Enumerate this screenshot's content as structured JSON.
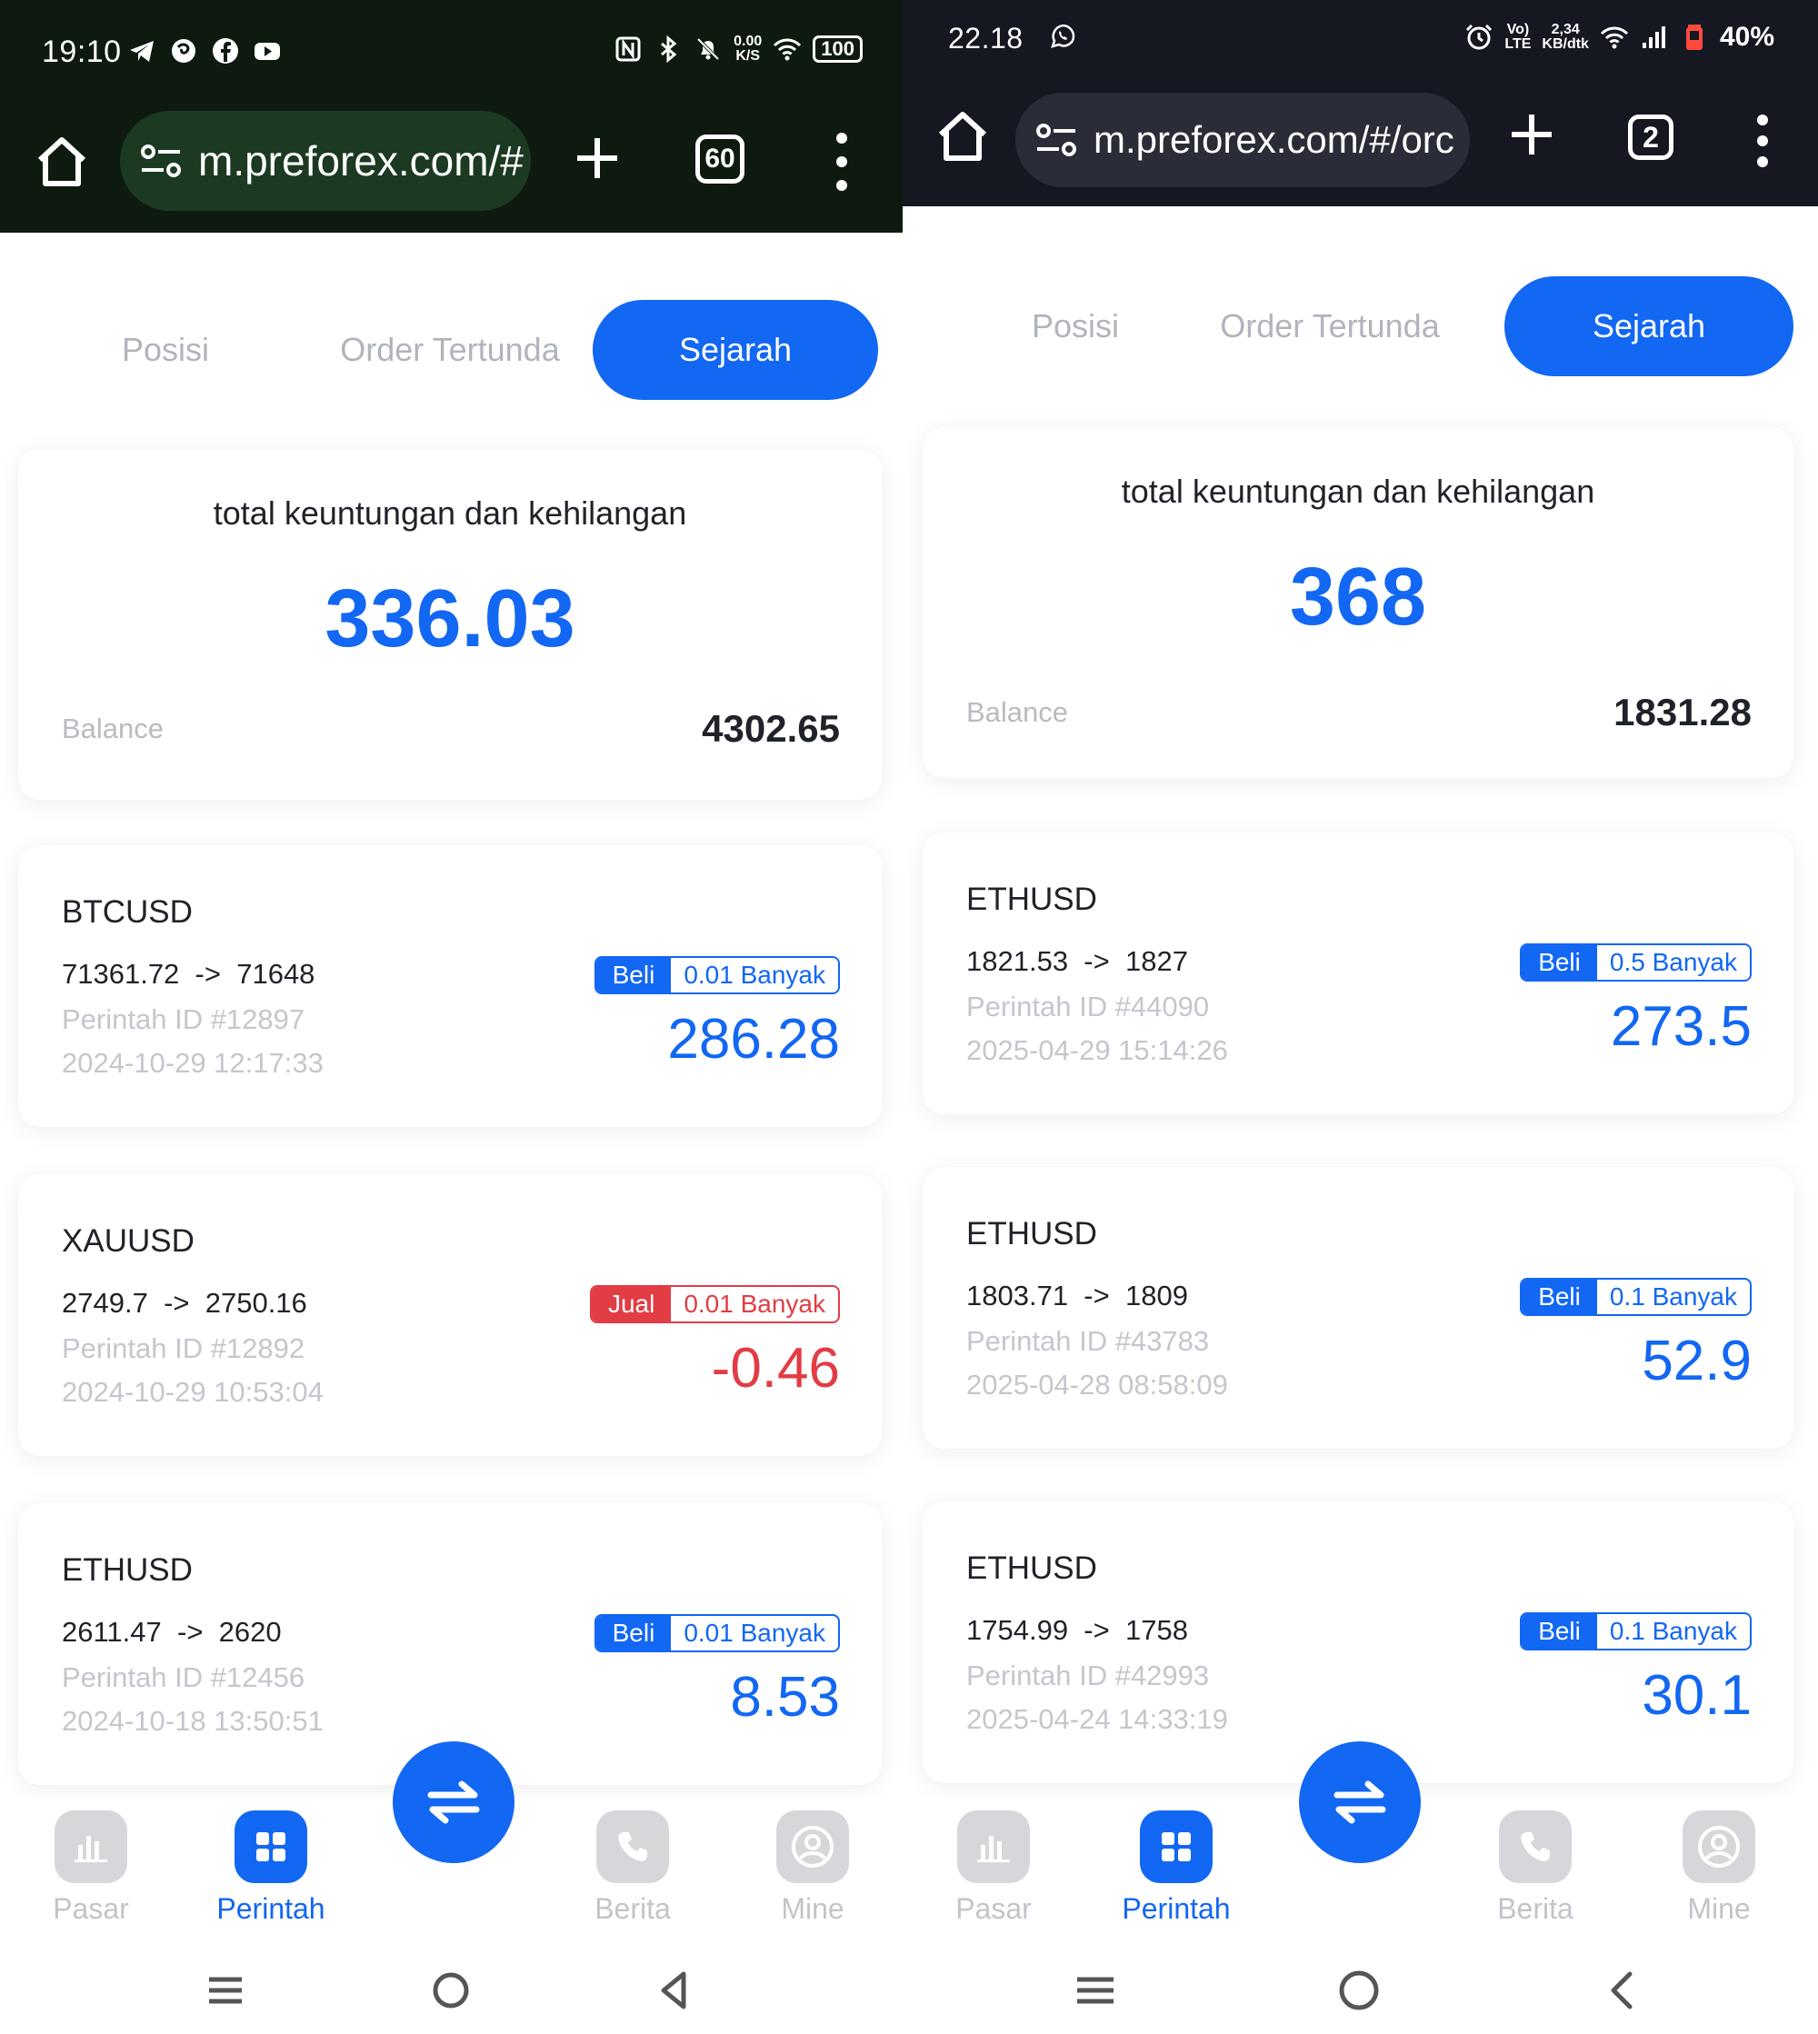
{
  "left": {
    "status": {
      "time": "19:10",
      "net_speed_top": "0.00",
      "net_speed_bottom": "K/S",
      "battery": "100"
    },
    "browser": {
      "url": "m.preforex.com/#",
      "tab_count": "60"
    },
    "tabs": [
      "Posisi",
      "Order Tertunda",
      "Sejarah"
    ],
    "summary": {
      "title": "total keuntungan dan kehilangan",
      "total": "336.03",
      "balance_label": "Balance",
      "balance": "4302.65"
    },
    "orders": [
      {
        "symbol": "BTCUSD",
        "open": "71361.72",
        "arrow": "->",
        "close": "71648",
        "id": "Perintah ID #12897",
        "time": "2024-10-29 12:17:33",
        "side": "Beli",
        "lots": "0.01 Banyak",
        "profit": "286.28",
        "type": "buy"
      },
      {
        "symbol": "XAUUSD",
        "open": "2749.7",
        "arrow": "->",
        "close": "2750.16",
        "id": "Perintah ID #12892",
        "time": "2024-10-29 10:53:04",
        "side": "Jual",
        "lots": "0.01 Banyak",
        "profit": "-0.46",
        "type": "sell"
      },
      {
        "symbol": "ETHUSD",
        "open": "2611.47",
        "arrow": "->",
        "close": "2620",
        "id": "Perintah ID #12456",
        "time": "2024-10-18 13:50:51",
        "side": "Beli",
        "lots": "0.01 Banyak",
        "profit": "8.53",
        "type": "buy"
      }
    ],
    "nav": [
      "Pasar",
      "Perintah",
      "Berita",
      "Mine"
    ]
  },
  "right": {
    "status": {
      "time": "22.18",
      "net_speed_top": "2,34",
      "net_speed_bottom": "KB/dtk",
      "lte": "LTE",
      "battery": "40%"
    },
    "browser": {
      "url": "m.preforex.com/#/orc",
      "tab_count": "2"
    },
    "tabs": [
      "Posisi",
      "Order Tertunda",
      "Sejarah"
    ],
    "summary": {
      "title": "total keuntungan dan kehilangan",
      "total": "368",
      "balance_label": "Balance",
      "balance": "1831.28"
    },
    "orders": [
      {
        "symbol": "ETHUSD",
        "open": "1821.53",
        "arrow": "->",
        "close": "1827",
        "id": "Perintah ID #44090",
        "time": "2025-04-29 15:14:26",
        "side": "Beli",
        "lots": "0.5 Banyak",
        "profit": "273.5",
        "type": "buy"
      },
      {
        "symbol": "ETHUSD",
        "open": "1803.71",
        "arrow": "->",
        "close": "1809",
        "id": "Perintah ID #43783",
        "time": "2025-04-28 08:58:09",
        "side": "Beli",
        "lots": "0.1 Banyak",
        "profit": "52.9",
        "type": "buy"
      },
      {
        "symbol": "ETHUSD",
        "open": "1754.99",
        "arrow": "->",
        "close": "1758",
        "id": "Perintah ID #42993",
        "time": "2025-04-24 14:33:19",
        "side": "Beli",
        "lots": "0.1 Banyak",
        "profit": "30.1",
        "type": "buy"
      }
    ],
    "nav": [
      "Pasar",
      "Perintah",
      "Berita",
      "Mine"
    ]
  },
  "colors": {
    "accent": "#1267f3",
    "loss": "#e23c45",
    "muted": "#c3c7cd",
    "text": "#1f2329"
  }
}
